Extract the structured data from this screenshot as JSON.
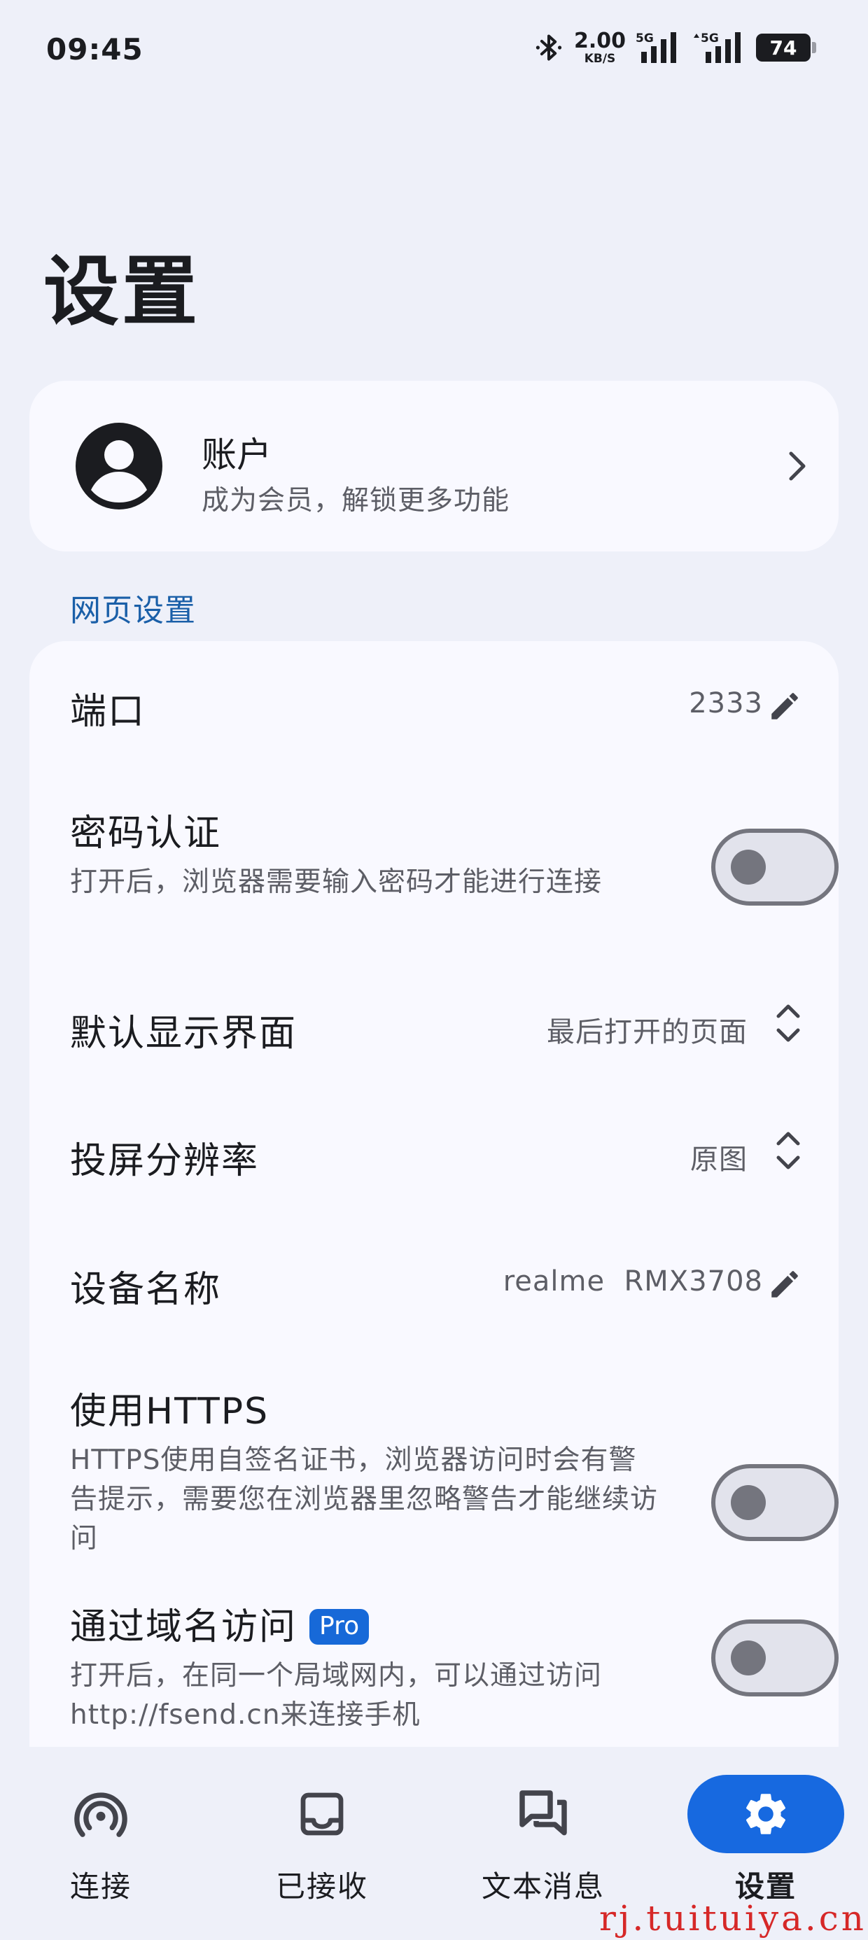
{
  "status_bar": {
    "time": "09:45",
    "net_speed_value": "2.00",
    "net_speed_unit": "KB/S",
    "signal1_label": "5G",
    "signal2_label": "5G",
    "battery": "74"
  },
  "page": {
    "title": "设置"
  },
  "account": {
    "title": "账户",
    "subtitle": "成为会员，解锁更多功能"
  },
  "section": {
    "web_settings": "网页设置"
  },
  "settings": {
    "port": {
      "title": "端口",
      "value": "2333"
    },
    "password_auth": {
      "title": "密码认证",
      "desc": "打开后，浏览器需要输入密码才能进行连接",
      "enabled": false
    },
    "default_view": {
      "title": "默认显示界面",
      "value": "最后打开的页面"
    },
    "cast_resolution": {
      "title": "投屏分辨率",
      "value": "原图"
    },
    "device_name": {
      "title": "设备名称",
      "value": "realme  RMX3708"
    },
    "https": {
      "title": "使用HTTPS",
      "desc": "HTTPS使用自签名证书，浏览器访问时会有警告提示，需要您在浏览器里忽略警告才能继续访问",
      "enabled": false
    },
    "domain_access": {
      "title": "通过域名访问",
      "badge": "Pro",
      "desc": "打开后，在同一个局域网内，可以通过访问http://fsend.cn来连接手机",
      "enabled": false
    }
  },
  "nav": {
    "items": [
      {
        "label": "连接",
        "icon": "broadcast-icon"
      },
      {
        "label": "已接收",
        "icon": "inbox-icon"
      },
      {
        "label": "文本消息",
        "icon": "chat-icon"
      },
      {
        "label": "设置",
        "icon": "gear-icon"
      }
    ],
    "active_index": 3,
    "active_color": "#1769e0"
  },
  "watermark": "rj.tuituiya.cn",
  "colors": {
    "accent": "#1a5fa8",
    "background": "#eef0f9",
    "card": "#f9f9ff"
  }
}
